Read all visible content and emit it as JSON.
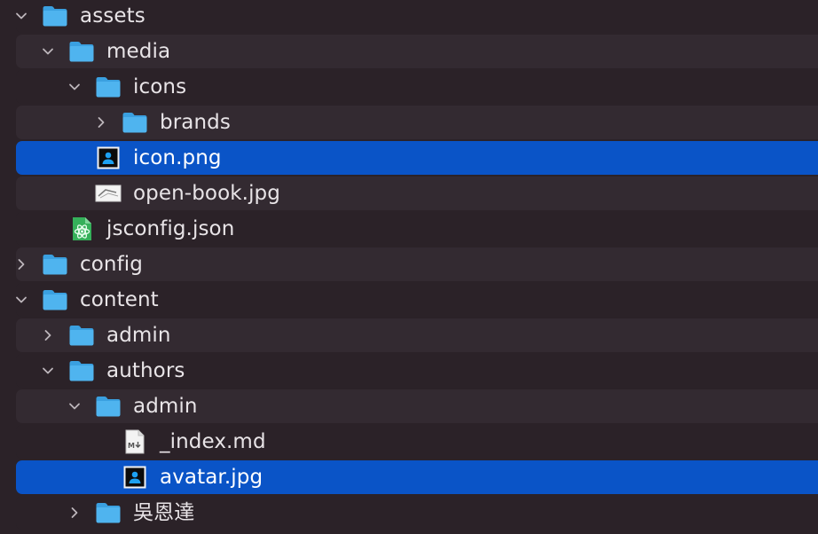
{
  "tree": {
    "rows": [
      {
        "label": "assets",
        "kind": "folder",
        "depth": 0,
        "expanded": true,
        "icon": "folder-icon"
      },
      {
        "label": "media",
        "kind": "folder",
        "depth": 1,
        "expanded": true,
        "icon": "folder-icon"
      },
      {
        "label": "icons",
        "kind": "folder",
        "depth": 2,
        "expanded": true,
        "icon": "folder-icon"
      },
      {
        "label": "brands",
        "kind": "folder",
        "depth": 3,
        "expanded": false,
        "icon": "folder-icon"
      },
      {
        "label": "icon.png",
        "kind": "file",
        "depth": 2,
        "selected": true,
        "icon": "image-file-icon"
      },
      {
        "label": "open-book.jpg",
        "kind": "file",
        "depth": 2,
        "icon": "image-thumbnail-icon"
      },
      {
        "label": "jsconfig.json",
        "kind": "file",
        "depth": 1,
        "icon": "atom-json-file-icon"
      },
      {
        "label": "config",
        "kind": "folder",
        "depth": 0,
        "expanded": false,
        "icon": "folder-icon"
      },
      {
        "label": "content",
        "kind": "folder",
        "depth": 0,
        "expanded": true,
        "icon": "folder-icon"
      },
      {
        "label": "admin",
        "kind": "folder",
        "depth": 1,
        "expanded": false,
        "icon": "folder-icon"
      },
      {
        "label": "authors",
        "kind": "folder",
        "depth": 1,
        "expanded": true,
        "icon": "folder-icon"
      },
      {
        "label": "admin",
        "kind": "folder",
        "depth": 2,
        "expanded": true,
        "icon": "folder-icon"
      },
      {
        "label": "_index.md",
        "kind": "file",
        "depth": 3,
        "icon": "markdown-file-icon"
      },
      {
        "label": "avatar.jpg",
        "kind": "file",
        "depth": 3,
        "selected": true,
        "icon": "image-file-icon"
      },
      {
        "label": "吳恩達",
        "kind": "folder",
        "depth": 2,
        "expanded": false,
        "icon": "folder-icon"
      }
    ]
  },
  "colors": {
    "background": "#2b2228",
    "alternate_row": "#332a31",
    "selection": "#0a54c7",
    "folder": "#4fb4ef",
    "text": "#e8e4e7"
  }
}
